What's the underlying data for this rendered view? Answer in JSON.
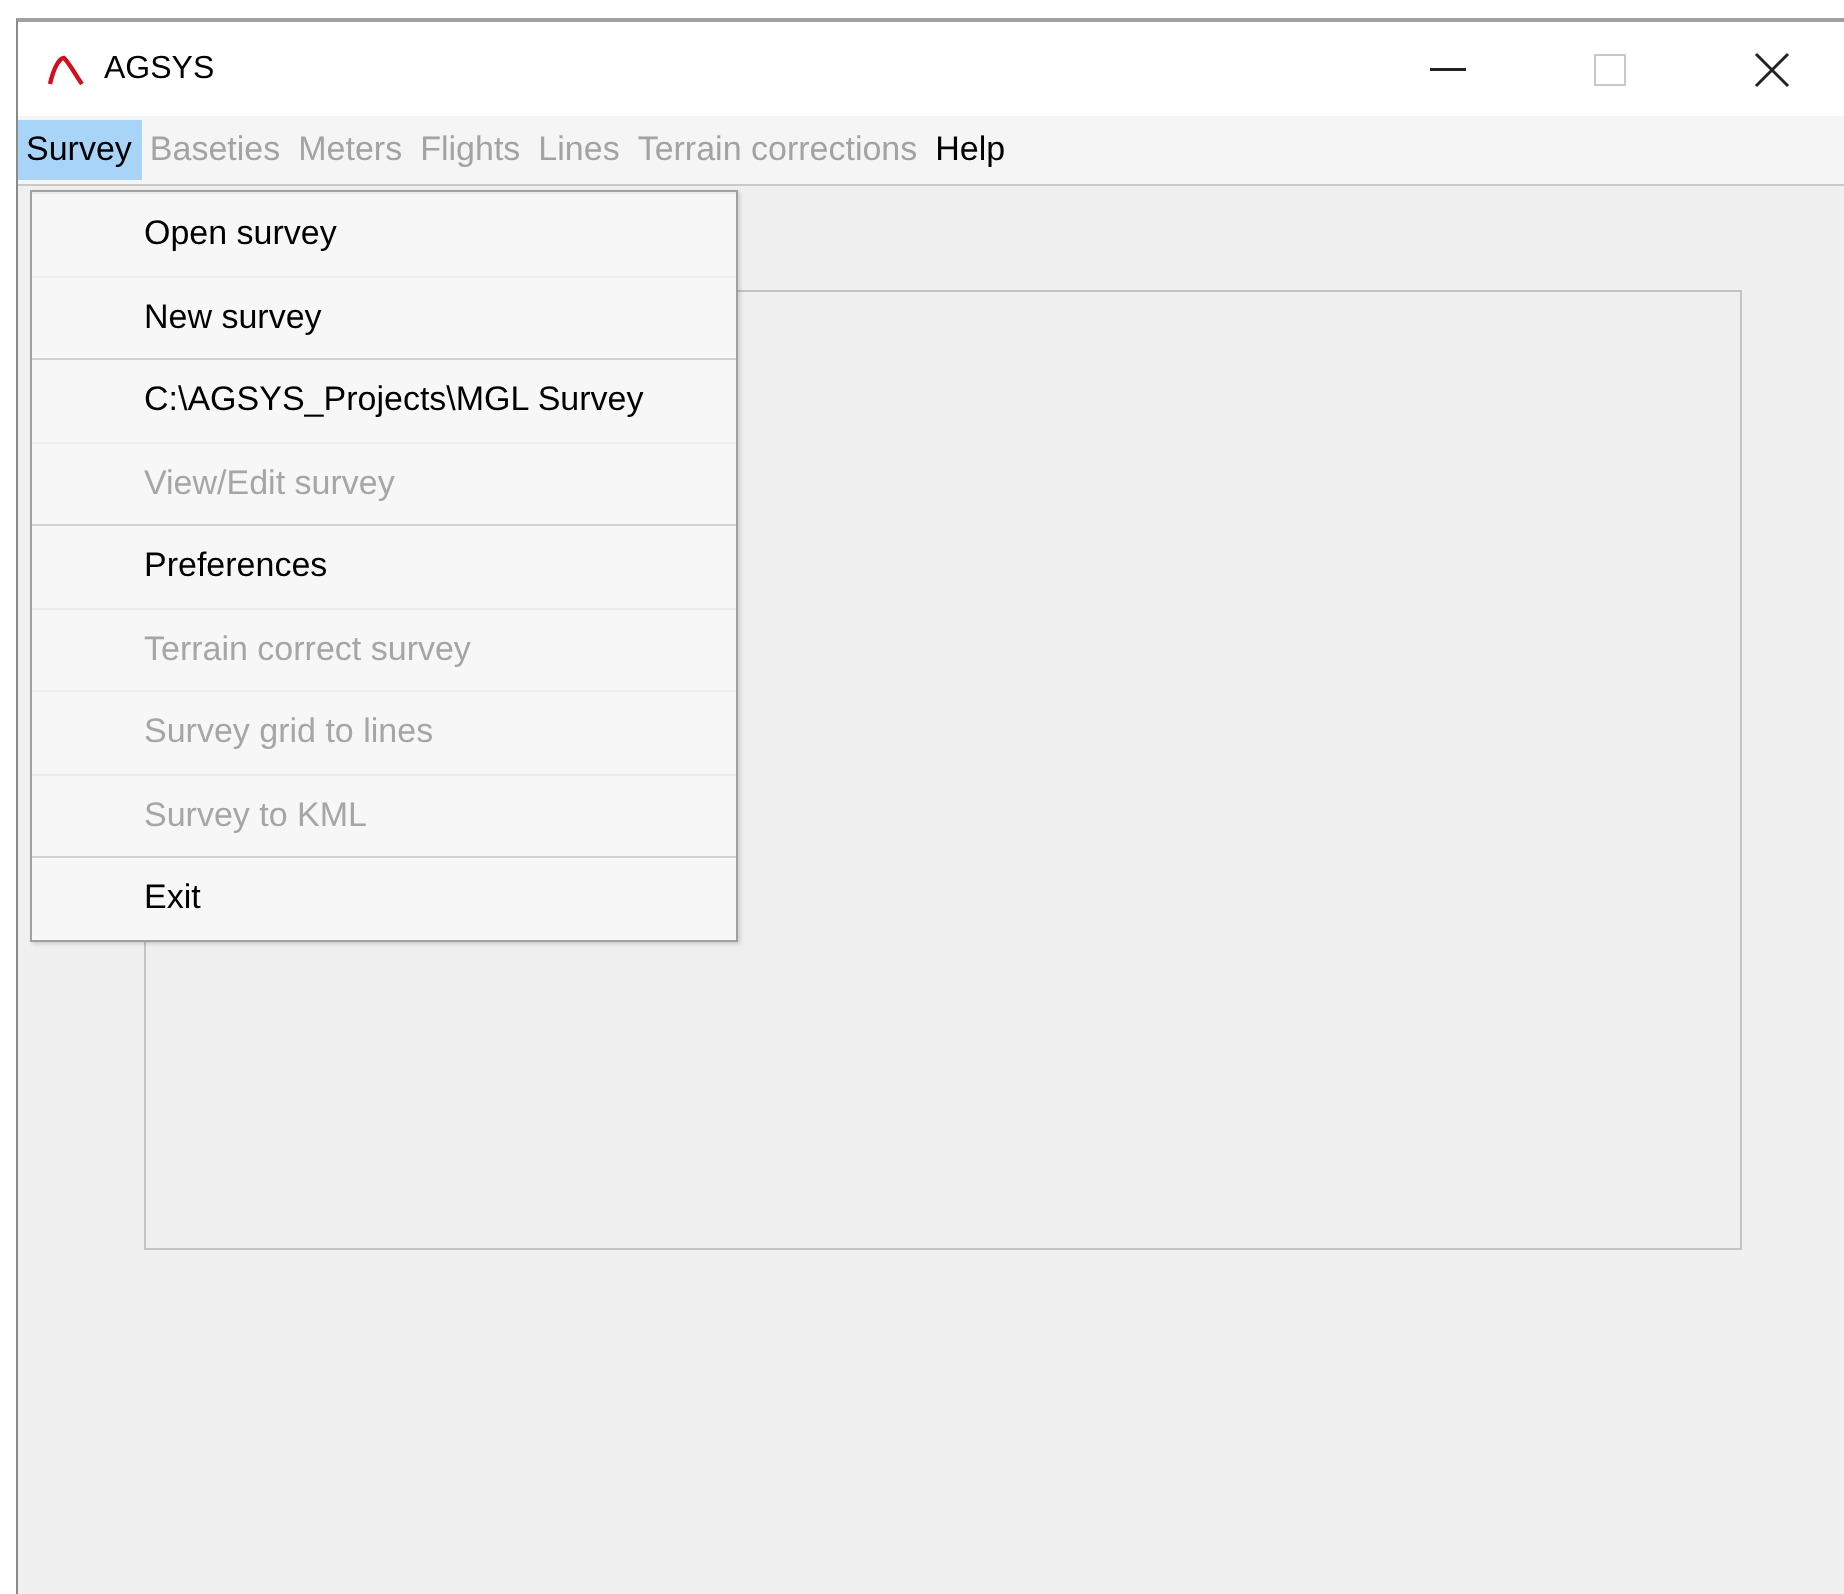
{
  "window": {
    "title": "AGSYS"
  },
  "menubar": [
    {
      "label": "Survey",
      "selected": true,
      "disabled": false
    },
    {
      "label": "Baseties",
      "selected": false,
      "disabled": true
    },
    {
      "label": "Meters",
      "selected": false,
      "disabled": true
    },
    {
      "label": "Flights",
      "selected": false,
      "disabled": true
    },
    {
      "label": "Lines",
      "selected": false,
      "disabled": true
    },
    {
      "label": "Terrain corrections",
      "selected": false,
      "disabled": true
    },
    {
      "label": "Help",
      "selected": false,
      "disabled": false
    }
  ],
  "menu": [
    {
      "label": "Open survey",
      "disabled": false,
      "divider_above": false
    },
    {
      "label": "New survey",
      "disabled": false,
      "divider_above": false
    },
    {
      "label": "C:\\AGSYS_Projects\\MGL Survey",
      "disabled": false,
      "divider_above": true
    },
    {
      "label": "View/Edit survey",
      "disabled": true,
      "divider_above": false
    },
    {
      "label": "Preferences",
      "disabled": false,
      "divider_above": true
    },
    {
      "label": "Terrain correct survey",
      "disabled": true,
      "divider_above": false
    },
    {
      "label": "Survey grid to lines",
      "disabled": true,
      "divider_above": false
    },
    {
      "label": "Survey to KML",
      "disabled": true,
      "divider_above": false
    },
    {
      "label": "Exit",
      "disabled": false,
      "divider_above": true
    }
  ]
}
